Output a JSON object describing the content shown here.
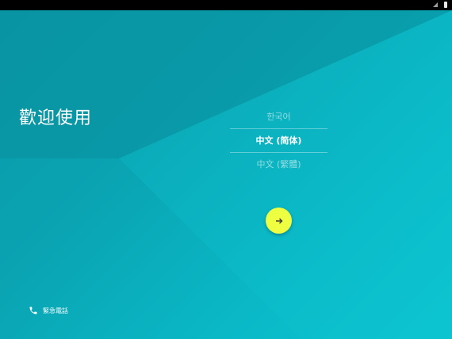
{
  "colors": {
    "background_start": "#0a99a8",
    "background_end": "#0bc6d1",
    "accent_button": "#eeff41",
    "text_primary": "#ffffff",
    "status_bar": "#000000"
  },
  "welcome": {
    "title": "歡迎使用"
  },
  "languages": {
    "items": [
      {
        "label": "한국어",
        "selected": false
      },
      {
        "label": "中文 (简体)",
        "selected": true
      },
      {
        "label": "中文 (繁體)",
        "selected": false
      }
    ]
  },
  "next_button": {
    "icon": "arrow-right-icon"
  },
  "emergency": {
    "icon": "phone-icon",
    "label": "緊急電話"
  },
  "status_bar": {
    "icons": [
      "signal-icon",
      "battery-icon"
    ]
  }
}
